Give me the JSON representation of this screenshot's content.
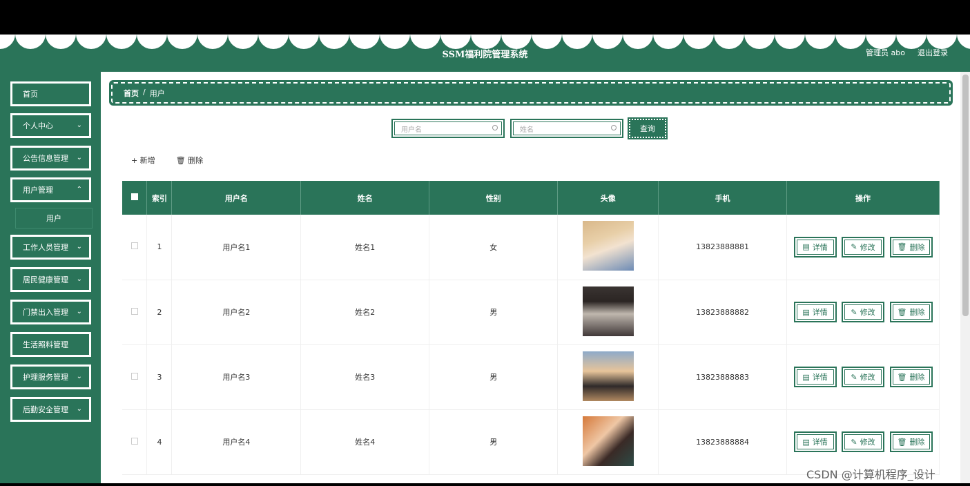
{
  "header": {
    "title": "SSM福利院管理系统",
    "user_label": "管理员 abo",
    "logout": "退出登录"
  },
  "sidebar": {
    "items": [
      {
        "label": "首页",
        "chevron": false
      },
      {
        "label": "个人中心",
        "chevron": true
      },
      {
        "label": "公告信息管理",
        "chevron": true
      },
      {
        "label": "用户管理",
        "chevron": true
      },
      {
        "label": "工作人员管理",
        "chevron": true
      },
      {
        "label": "居民健康管理",
        "chevron": true
      },
      {
        "label": "门禁出入管理",
        "chevron": true
      },
      {
        "label": "生活照料管理",
        "chevron": true
      },
      {
        "label": "护理服务管理",
        "chevron": true
      },
      {
        "label": "后勤安全管理",
        "chevron": true
      }
    ],
    "sub_item": "用户"
  },
  "breadcrumb": {
    "home": "首页",
    "sep": "/",
    "current": "用户"
  },
  "search": {
    "username_placeholder": "用户名",
    "name_placeholder": "姓名",
    "query_button": "查询"
  },
  "toolbar": {
    "add": "+ 新增",
    "delete": "🗑 删除"
  },
  "table": {
    "headers": [
      "索引",
      "用户名",
      "姓名",
      "性别",
      "头像",
      "手机",
      "操作"
    ],
    "rows": [
      {
        "index": "1",
        "username": "用户名1",
        "name": "姓名1",
        "gender": "女",
        "phone": "13823888881"
      },
      {
        "index": "2",
        "username": "用户名2",
        "name": "姓名2",
        "gender": "男",
        "phone": "13823888882"
      },
      {
        "index": "3",
        "username": "用户名3",
        "name": "姓名3",
        "gender": "男",
        "phone": "13823888883"
      },
      {
        "index": "4",
        "username": "用户名4",
        "name": "姓名4",
        "gender": "男",
        "phone": "13823888884"
      }
    ],
    "actions": {
      "detail": "详情",
      "edit": "修改",
      "delete": "删除"
    }
  },
  "watermark": "CSDN @计算机程序_设计",
  "colors": {
    "primary": "#2a7459",
    "white": "#ffffff"
  }
}
